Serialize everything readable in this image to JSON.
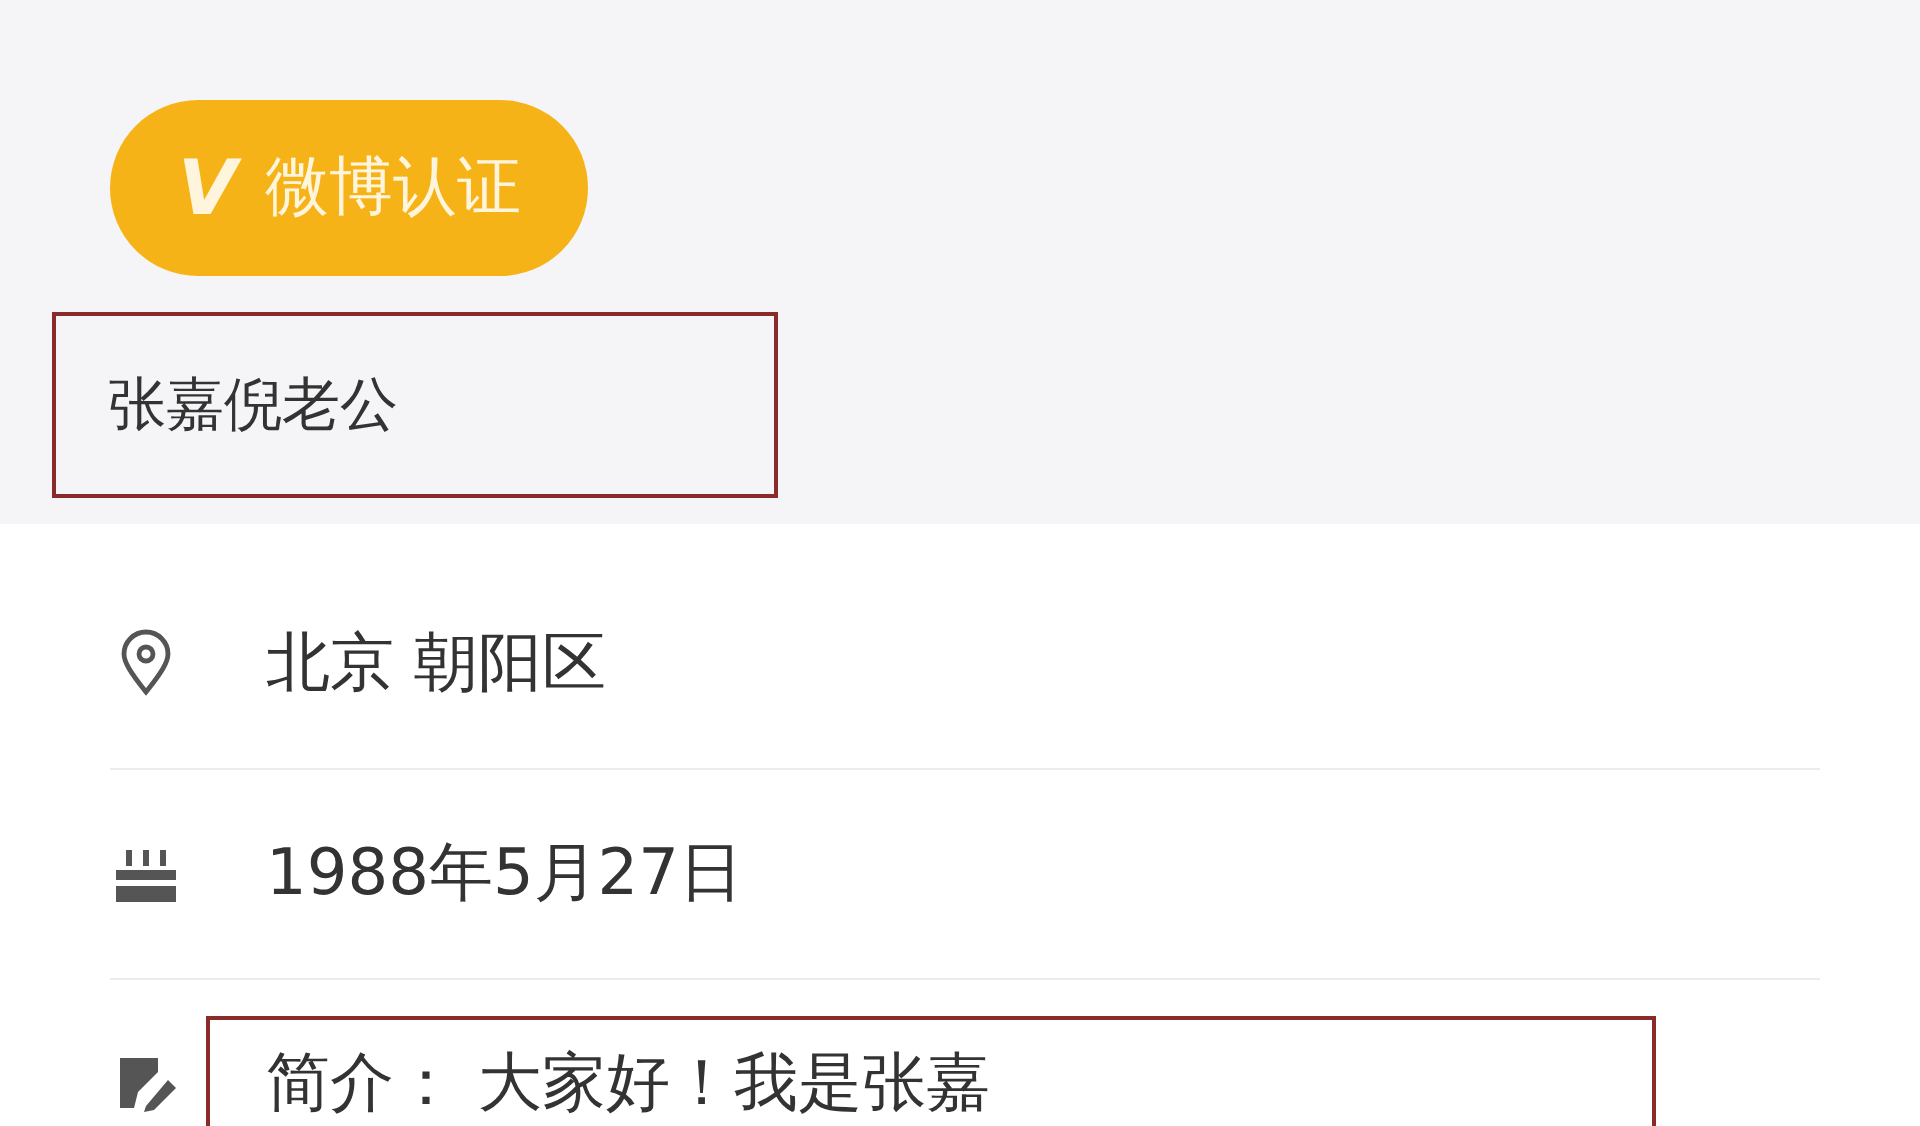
{
  "badge": {
    "mark": "V",
    "label": "微博认证"
  },
  "name": {
    "text": "张嘉倪老公",
    "highlighted": true
  },
  "info_rows": [
    {
      "kind": "location",
      "text": "北京 朝阳区",
      "highlighted": false
    },
    {
      "kind": "birthday",
      "text": "1988年5月27日",
      "highlighted": false
    },
    {
      "kind": "bio",
      "text": "简介：  大家好！我是张嘉",
      "highlighted": true
    }
  ]
}
